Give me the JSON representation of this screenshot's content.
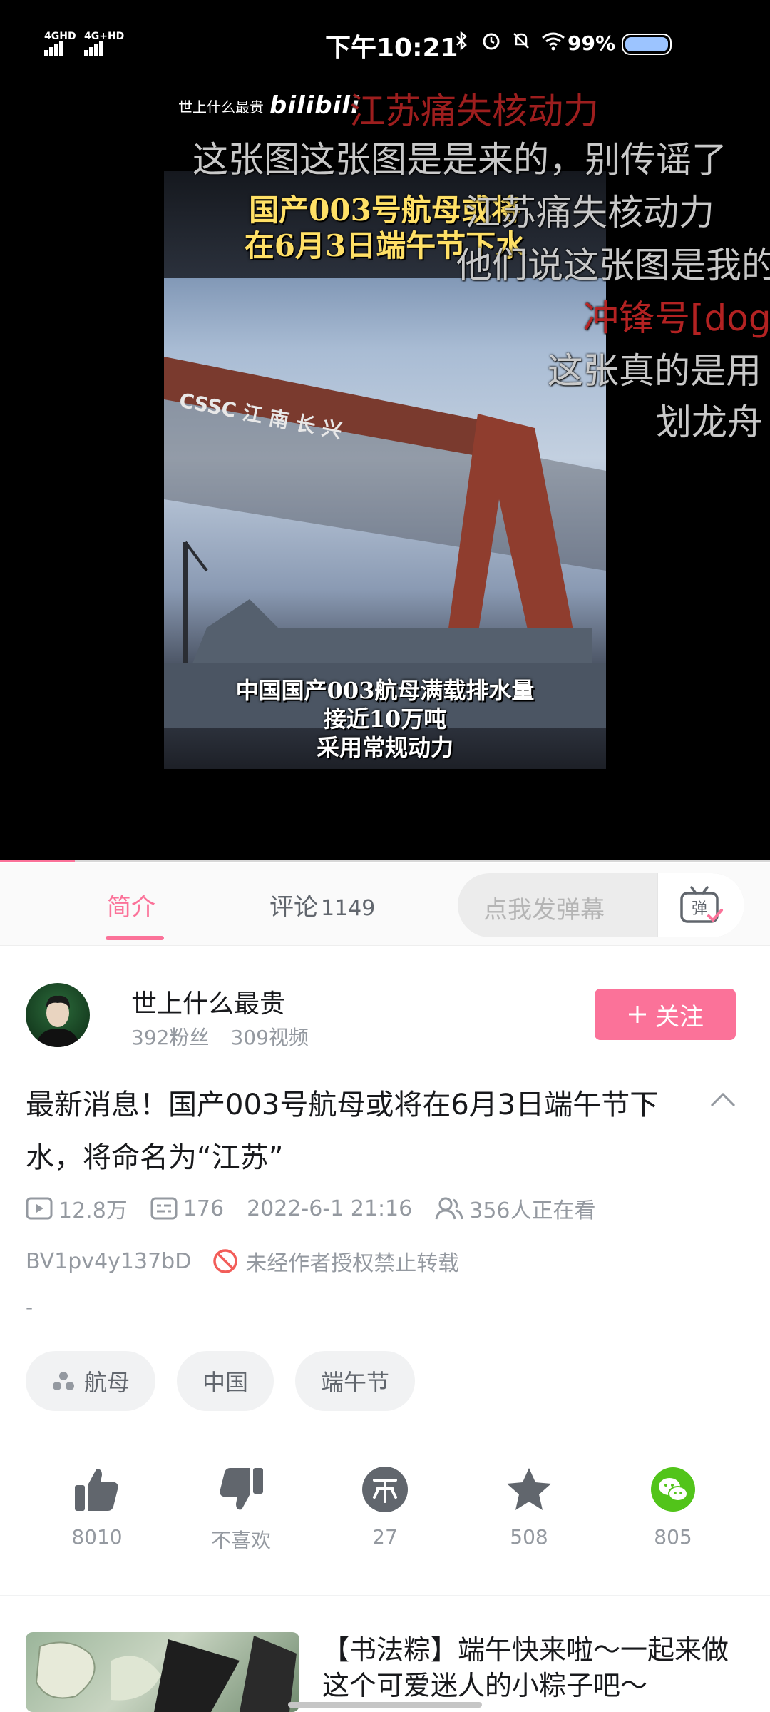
{
  "status_bar": {
    "signal_1": "4GHD",
    "signal_2": "4G+HD",
    "time": "下午10:21",
    "battery": "99%"
  },
  "video": {
    "watermark_name": "世上什么最贵",
    "watermark_brand": "bilibili",
    "frame_caption_top_1": "国产003号航母或将",
    "frame_caption_top_2": "在6月3日端午节下水",
    "gantry_text": "CSSC 江 南 长 兴",
    "frame_caption_bottom_1": "中国国产003航母满载排水量",
    "frame_caption_bottom_2": "接近10万吨",
    "frame_caption_bottom_3": "采用常规动力",
    "danmaku": [
      "江苏痛失核动力",
      "这张图这张图是是来的，别传谣了",
      "江苏痛失核动力",
      "他们说这张图是我的",
      "冲锋号[dog]",
      "这张真的是用",
      "划龙舟"
    ],
    "progress": 0.097
  },
  "tabs": {
    "intro": "简介",
    "comments": "评论",
    "comments_count": "1149",
    "danmaku_placeholder": "点我发弹幕",
    "danmaku_button": "弹"
  },
  "uploader": {
    "name": "世上什么最贵",
    "fans": "392粉丝",
    "videos": "309视频",
    "follow_label": "关注"
  },
  "video_info": {
    "title": "最新消息！国产003号航母或将在6月3日端午节下水，将命名为“江苏”",
    "views": "12.8万",
    "danmaku_count": "176",
    "publish_time": "2022-6-1 21:16",
    "watching": "356人正在看",
    "bvid": "BV1pv4y137bD",
    "copyright": "未经作者授权禁止转载",
    "description": "-"
  },
  "tags": [
    "航母",
    "中国",
    "端午节"
  ],
  "actions": {
    "like": "8010",
    "dislike": "不喜欢",
    "coin": "27",
    "favorite": "508",
    "share": "805"
  },
  "recommendation": {
    "title": "【书法粽】端午快来啦～一起来做这个可爱迷人的小粽子吧～"
  },
  "colors": {
    "accent": "#fb7299",
    "text_secondary": "#9499a0",
    "copyright_red": "#f25d59",
    "wechat_green": "#52c41a"
  }
}
